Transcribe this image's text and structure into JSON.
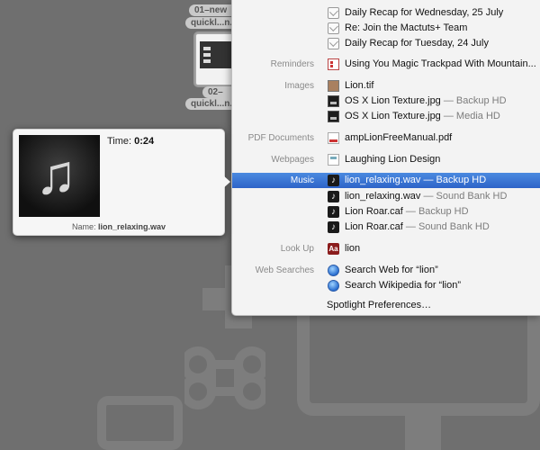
{
  "desktop": {
    "file1_label": "01–new quickl...",
    "file1_line1": "01–new",
    "file1_line2": "quickl...n.m4v",
    "file2_line1": "02–",
    "file2_line2": "quickl...n.m4v"
  },
  "spotlight": {
    "rows": [
      {
        "category": "",
        "text": "Daily Recap for Wednesday, 25 July",
        "sub": "",
        "icon": "mail-icon"
      },
      {
        "category": "",
        "text": "Re: Join the Mactuts+ Team",
        "sub": "",
        "icon": "mail-icon"
      },
      {
        "category": "",
        "text": "Daily Recap for Tuesday, 24 July",
        "sub": "",
        "icon": "mail-icon"
      },
      {
        "category": "Reminders",
        "text": "Using You Magic Trackpad With Mountain...",
        "sub": "",
        "icon": "reminder-icon"
      },
      {
        "category": "Images",
        "text": "Lion.tif",
        "sub": "",
        "icon": "tif-image-icon"
      },
      {
        "category": "",
        "text": "OS X Lion Texture.jpg",
        "sub": " — Backup HD",
        "icon": "jpg-image-icon"
      },
      {
        "category": "",
        "text": "OS X Lion Texture.jpg",
        "sub": " — Media HD",
        "icon": "jpg-image-icon"
      },
      {
        "category": "PDF Documents",
        "text": "ampLionFreeManual.pdf",
        "sub": "",
        "icon": "pdf-icon"
      },
      {
        "category": "Webpages",
        "text": "Laughing Lion Design",
        "sub": "",
        "icon": "webpage-icon"
      },
      {
        "category": "Music",
        "text": "lion_relaxing.wav",
        "sub": " — Backup HD",
        "icon": "music-file-icon",
        "selected": true
      },
      {
        "category": "",
        "text": "lion_relaxing.wav",
        "sub": " — Sound Bank HD",
        "icon": "music-file-icon"
      },
      {
        "category": "",
        "text": "Lion Roar.caf",
        "sub": " — Backup HD",
        "icon": "music-file-icon"
      },
      {
        "category": "",
        "text": "Lion Roar.caf",
        "sub": " — Sound Bank HD",
        "icon": "music-file-icon"
      },
      {
        "category": "Look Up",
        "text": "lion",
        "sub": "",
        "icon": "dictionary-icon"
      },
      {
        "category": "Web Searches",
        "text": "Search Web for “lion”",
        "sub": "",
        "icon": "globe-icon"
      },
      {
        "category": "",
        "text": "Search Wikipedia for “lion”",
        "sub": "",
        "icon": "globe-icon"
      }
    ],
    "preferences": "Spotlight Preferences…"
  },
  "preview": {
    "time_label": "Time:",
    "time_value": "0:24",
    "name_label": "Name:",
    "name_value": "lion_relaxing.wav",
    "art_glyph": "♫"
  },
  "icon_glyphs": {
    "music": "♪",
    "dictionary": "Aa"
  },
  "colors": {
    "selection": "#2d63c8",
    "desktop": "#6f6f6f"
  }
}
